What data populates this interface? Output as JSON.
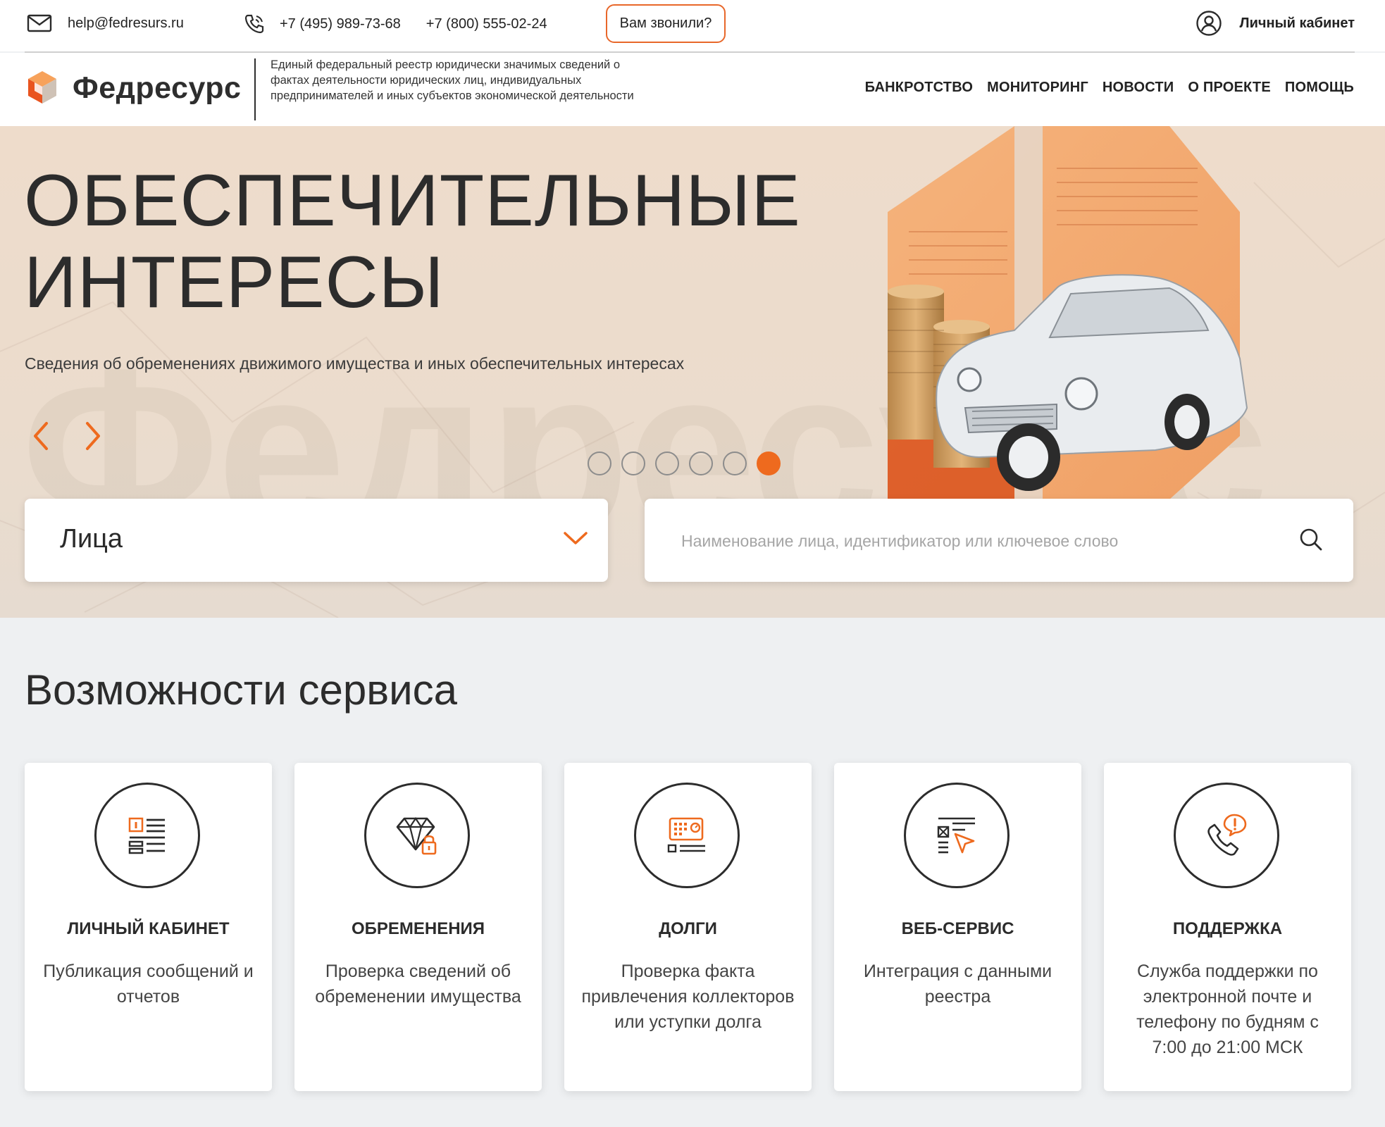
{
  "topbar": {
    "email": "help@fedresurs.ru",
    "phone1": "+7 (495) 989-73-68",
    "phone2": "+7 (800) 555-02-24",
    "call_button": "Вам звонили?",
    "cabinet": "Личный кабинет"
  },
  "header": {
    "logo_text": "Федресурс",
    "tagline": "Единый федеральный реестр юридически значимых сведений о фактах деятельности юридических лиц, индивидуальных предпринимателей и иных субъектов экономической деятельности",
    "nav": [
      "БАНКРОТСТВО",
      "МОНИТОРИНГ",
      "НОВОСТИ",
      "О ПРОЕКТЕ",
      "ПОМОЩЬ"
    ]
  },
  "hero": {
    "title_line1": "ОБЕСПЕЧИТЕЛЬНЫЕ",
    "title_line2": "ИНТЕРЕСЫ",
    "subtitle": "Сведения об обременениях движимого имущества и иных обеспечительных интересах",
    "watermark": "Федресурс",
    "slides_total": 6,
    "active_slide": 6
  },
  "search": {
    "select_value": "Лица",
    "placeholder": "Наименование лица, идентификатор или ключевое слово"
  },
  "features": {
    "title": "Возможности сервиса",
    "cards": [
      {
        "title": "ЛИЧНЫЙ КАБИНЕТ",
        "text": "Публикация сообщений и отчетов",
        "icon": "document-list-icon"
      },
      {
        "title": "ОБРЕМЕНЕНИЯ",
        "text": "Проверка сведений об обременении имущества",
        "icon": "diamond-lock-icon"
      },
      {
        "title": "ДОЛГИ",
        "text": "Проверка факта привлечения коллекторов или уступки долга",
        "icon": "safe-icon"
      },
      {
        "title": "ВЕБ-СЕРВИС",
        "text": "Интеграция с данными реестра",
        "icon": "web-form-cursor-icon"
      },
      {
        "title": "ПОДДЕРЖКА",
        "text": "Служба поддержки по электронной почте и телефону по будням с 7:00 до 21:00 МСК",
        "icon": "phone-alert-icon"
      }
    ]
  },
  "colors": {
    "accent": "#ee6a1e",
    "text": "#2b2b2b",
    "hero_bg": "#ebdccd",
    "page_bg": "#eef0f2"
  }
}
